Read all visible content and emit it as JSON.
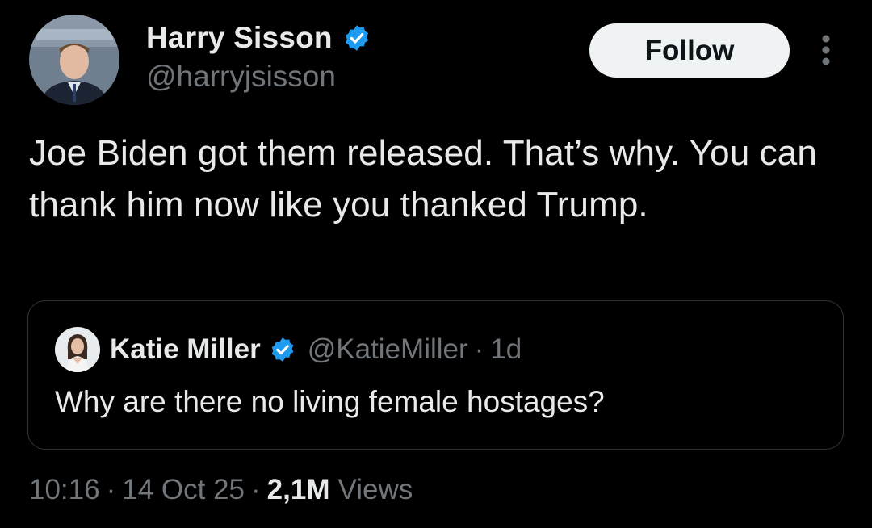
{
  "author": {
    "display_name": "Harry Sisson",
    "handle": "@harryjsisson",
    "verified": true,
    "avatar_icon": "person-photo-avatar"
  },
  "actions": {
    "follow_label": "Follow",
    "more_icon": "vertical-ellipsis-icon"
  },
  "tweet": {
    "text": "Joe Biden got them released. That’s why. You can thank him now like you thanked Trump."
  },
  "quoted_tweet": {
    "display_name": "Katie Miller",
    "handle": "@KatieMiller",
    "separator": "·",
    "time": "1d",
    "verified": true,
    "text": "Why are there no living female hostages?"
  },
  "meta": {
    "time": "10:16",
    "separator": "·",
    "date": "14 Oct 25",
    "views_count": "2,1M",
    "views_label": "Views"
  },
  "colors": {
    "background": "#000000",
    "primary_text": "#e7e9ea",
    "secondary_text": "#71767b",
    "verified_blue": "#1d9bf0",
    "follow_bg": "#eff3f4",
    "border": "#2f3336"
  }
}
